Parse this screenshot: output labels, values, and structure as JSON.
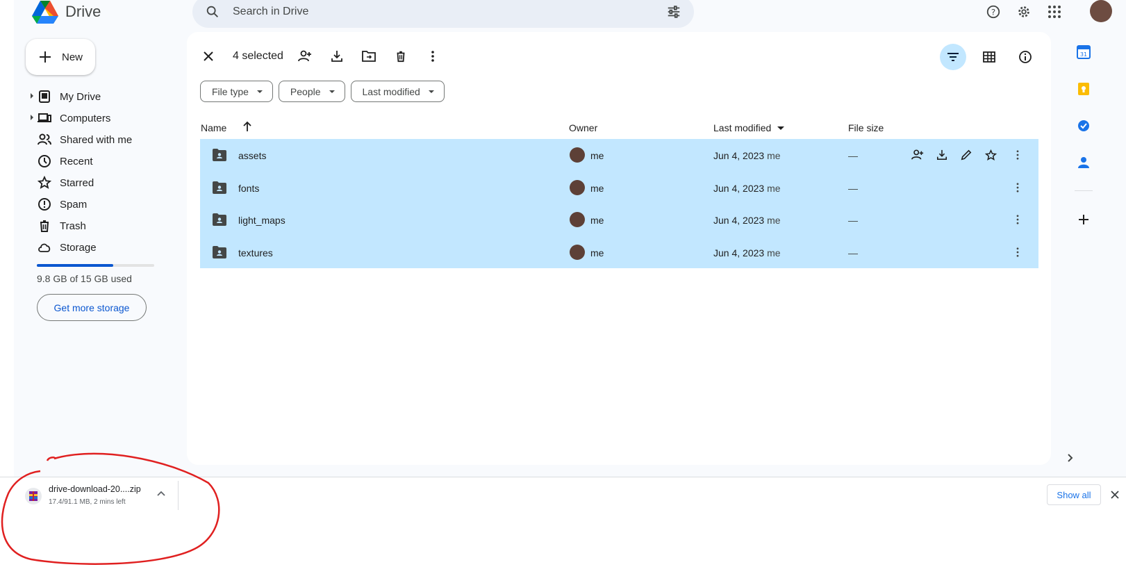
{
  "app": {
    "name": "Drive"
  },
  "search": {
    "placeholder": "Search in Drive"
  },
  "sidebar": {
    "new_label": "New",
    "items": [
      {
        "label": "My Drive",
        "icon": "my-drive-icon",
        "expandable": true
      },
      {
        "label": "Computers",
        "icon": "computers-icon",
        "expandable": true
      },
      {
        "label": "Shared with me",
        "icon": "shared-icon",
        "expandable": false
      },
      {
        "label": "Recent",
        "icon": "clock-icon",
        "expandable": false
      },
      {
        "label": "Starred",
        "icon": "star-icon",
        "expandable": false
      },
      {
        "label": "Spam",
        "icon": "spam-icon",
        "expandable": false
      },
      {
        "label": "Trash",
        "icon": "trash-icon",
        "expandable": false
      },
      {
        "label": "Storage",
        "icon": "cloud-icon",
        "expandable": false
      }
    ],
    "storage_used_fraction": 0.65,
    "storage_text": "9.8 GB of 15 GB used",
    "storage_button": "Get more storage"
  },
  "selection": {
    "count_label": "4 selected"
  },
  "filters": [
    "File type",
    "People",
    "Last modified"
  ],
  "table": {
    "headers": {
      "name": "Name",
      "owner": "Owner",
      "modified": "Last modified",
      "size": "File size"
    },
    "rows": [
      {
        "name": "assets",
        "owner": "me",
        "modified": "Jun 4, 2023",
        "modified_by": "me",
        "size": "—"
      },
      {
        "name": "fonts",
        "owner": "me",
        "modified": "Jun 4, 2023",
        "modified_by": "me",
        "size": "—"
      },
      {
        "name": "light_maps",
        "owner": "me",
        "modified": "Jun 4, 2023",
        "modified_by": "me",
        "size": "—"
      },
      {
        "name": "textures",
        "owner": "me",
        "modified": "Jun 4, 2023",
        "modified_by": "me",
        "size": "—"
      }
    ]
  },
  "download": {
    "filename": "drive-download-20....zip",
    "status": "17.4/91.1 MB, 2 mins left",
    "show_all": "Show all"
  },
  "colors": {
    "accent": "#0b57d0",
    "selected_row": "#c2e7ff",
    "annotation": "#e02020"
  }
}
